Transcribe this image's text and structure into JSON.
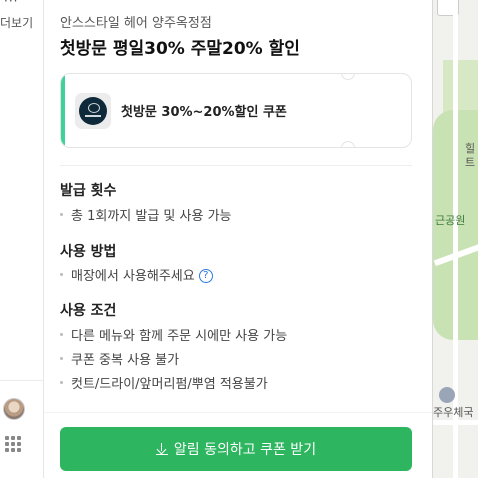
{
  "left_strip": {
    "more_text": "더보기",
    "dots": "···"
  },
  "panel": {
    "shop_name": "안스스타일 헤어 양주옥정점",
    "headline": "첫방문 평일30% 주말20% 할인",
    "coupon": {
      "title": "첫방문 30%~20%할인 쿠폰",
      "accent_color": "#3fd19a"
    },
    "sections": {
      "issue_count": {
        "title": "발급 횟수",
        "lines": [
          "총 1회까지 발급 및 사용 가능"
        ]
      },
      "usage_method": {
        "title": "사용 방법",
        "lines": [
          "매장에서 사용해주세요"
        ],
        "help_icon": "?"
      },
      "conditions": {
        "title": "사용 조건",
        "lines": [
          "다른 메뉴와 함께 주문 시에만 사용 가능",
          "쿠폰 중복 사용 불가",
          "컷트/드라이/앞머리펌/뿌염 적용불가"
        ]
      }
    },
    "cta": {
      "label": "알림 동의하고 쿠폰 받기",
      "color": "#2db560"
    }
  },
  "map": {
    "label_top": "힐",
    "label_top2": "트",
    "label_park": "근공원",
    "label_office": "주우체국"
  }
}
